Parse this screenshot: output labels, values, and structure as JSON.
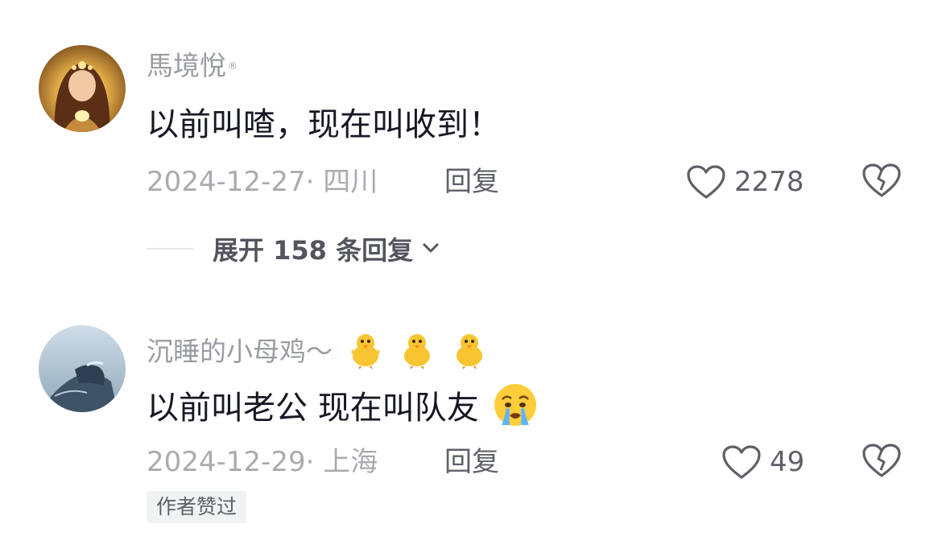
{
  "comments": [
    {
      "username": "馬境悅",
      "username_mark": "®",
      "text": "以前叫喳，现在叫收到！",
      "date_location": "2024-12-27· 四川",
      "reply_label": "回复",
      "likes": "2278",
      "expand_label": "展开 158 条回复"
    },
    {
      "username": "沉睡的小母鸡～",
      "username_emojis": [
        "baby-chick",
        "baby-chick",
        "baby-chick"
      ],
      "text": "以前叫老公 现在叫队友",
      "text_emoji": "crying-face",
      "date_location": "2024-12-29· 上海",
      "reply_label": "回复",
      "likes": "49",
      "badge": "作者赞过"
    }
  ],
  "colors": {
    "username": "#9a9ca3",
    "text": "#161823",
    "meta": "#a9abb1",
    "action": "#5e6068",
    "badge_bg": "#f1f2f4"
  },
  "icons": {
    "like": "heart-outline-icon",
    "dislike": "broken-heart-icon",
    "expand": "chevron-down-icon"
  }
}
